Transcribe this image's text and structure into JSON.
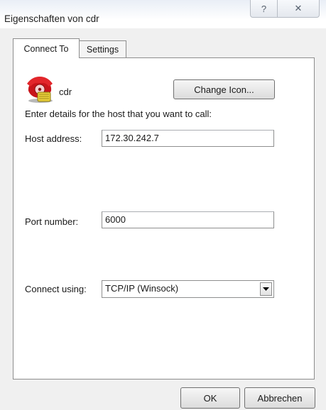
{
  "window": {
    "title": "Eigenschaften von cdr",
    "help_glyph": "?",
    "close_glyph": "✕"
  },
  "tabs": [
    {
      "label": "Connect To",
      "selected": true
    },
    {
      "label": "Settings",
      "selected": false
    }
  ],
  "connect_to": {
    "connection_icon": "red-telephone-icon",
    "connection_name": "cdr",
    "change_icon_label": "Change Icon...",
    "instruction": "Enter details for the host that you want to call:",
    "host_address": {
      "label": "Host address:",
      "value": "172.30.242.7"
    },
    "port_number": {
      "label": "Port number:",
      "value": "6000"
    },
    "connect_using": {
      "label": "Connect using:",
      "value": "TCP/IP (Winsock)"
    }
  },
  "buttons": {
    "ok": "OK",
    "cancel": "Abbrechen"
  }
}
